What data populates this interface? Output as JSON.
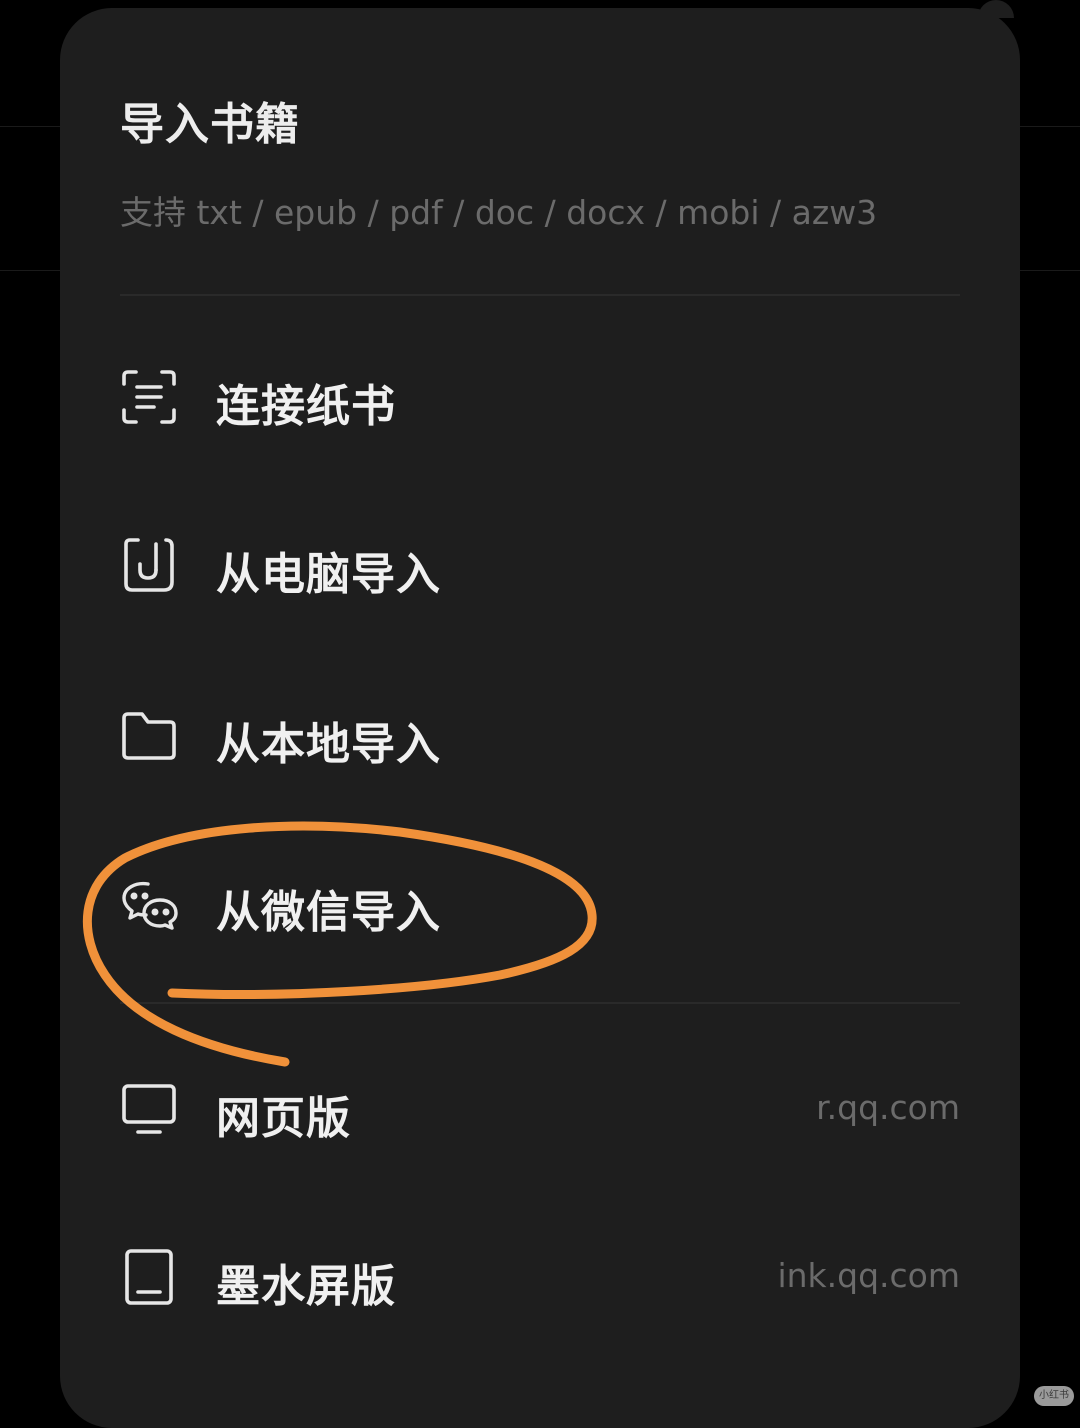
{
  "dialog": {
    "title": "导入书籍",
    "subtitle": "支持 txt / epub / pdf / doc / docx / mobi / azw3"
  },
  "menu": [
    {
      "id": "connect-paper",
      "label": "连接纸书",
      "icon": "scan-icon",
      "url": ""
    },
    {
      "id": "import-from-computer",
      "label": "从电脑导入",
      "icon": "clip-upload-icon",
      "url": ""
    },
    {
      "id": "import-from-local",
      "label": "从本地导入",
      "icon": "folder-icon",
      "url": ""
    },
    {
      "id": "import-from-wechat",
      "label": "从微信导入",
      "icon": "wechat-icon",
      "url": ""
    },
    {
      "id": "web-version",
      "label": "网页版",
      "icon": "monitor-icon",
      "url": "r.qq.com"
    },
    {
      "id": "eink-version",
      "label": "墨水屏版",
      "icon": "tablet-icon",
      "url": "ink.qq.com"
    }
  ],
  "annotation": {
    "color": "#f0913a",
    "target": "import-from-wechat"
  },
  "watermark": {
    "text": "小红书"
  }
}
